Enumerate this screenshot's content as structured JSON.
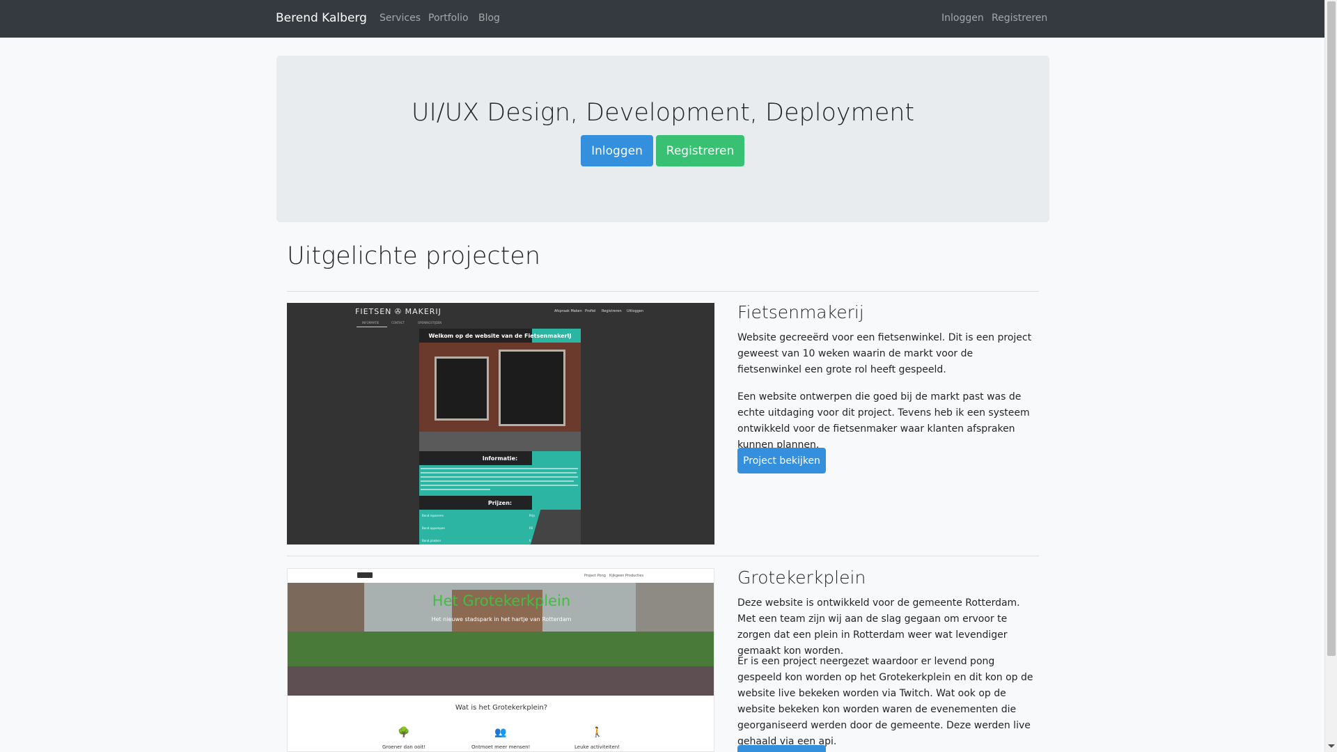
{
  "navbar": {
    "brand": "Berend Kalberg",
    "links": [
      "Services",
      "Portfolio",
      "Blog"
    ],
    "right_links": [
      "Inloggen",
      "Registreren"
    ]
  },
  "jumbotron": {
    "title": "UI/UX Design, Development, Deployment",
    "login_button": "Inloggen",
    "register_button": "Registreren"
  },
  "section": {
    "title": "Uitgelichte projecten"
  },
  "projects": [
    {
      "title": "Fietsenmakerij",
      "paragraph1": "Website gecreeërd voor een fietsenwinkel. Dit is een project geweest van 10 weken waarin de markt voor de fietsenwinkel een grote rol heeft gespeeld.",
      "paragraph2": "Een website ontwerpen die goed bij de markt past was de echte uitdaging voor dit project. Tevens heb ik een systeem ontwikkeld voor de fietsenmaker waar klanten afspraken kunnen plannen.",
      "button": "Project bekijken",
      "screenshot": {
        "logo": "FIETSEN ✇ MAKERIJ",
        "menu": [
          "Afspraak Maken",
          "Profiel",
          "Registreren",
          "Uitloggen"
        ],
        "subnav": [
          "INFORMATIE",
          "CONTACT",
          "OPENINGSTIJDEN"
        ],
        "welcome": "Welkom op de website van de FietsenmakerIJ",
        "info_header": "Informatie:",
        "prices_header": "Prijzen:",
        "price_rows": [
          "Band repareren",
          "Band oppompen",
          "Band plakken"
        ],
        "price_values": [
          "Prijs",
          "€6",
          "€..."
        ]
      }
    },
    {
      "title": "Grotekerkplein",
      "paragraph1": "Deze website is ontwikkeld voor de gemeente Rotterdam. Met een team zijn wij aan de slag gegaan om ervoor te zorgen dat een plein in Rotterdam weer wat levendiger gemaakt kon worden.",
      "paragraph2": "Er is een project neergezet waardoor er levend pong gespeeld kon worden op het Grotekerkplein en dit kon op de website live bekeken worden via Twitch. Wat ook op de website bekeken kon worden waren de evenementen die georganiseerd werden door de gemeente. Deze werden live gehaald via een api.",
      "screenshot": {
        "menu": [
          "Project Pong",
          "Kijkgeen Producties"
        ],
        "hero_title": "Het Grotekerkplein",
        "hero_subtitle": "Het nieuwe stadspark in het hartje van Rotterdam",
        "question": "Wat is het Grotekerkplein?",
        "features": [
          "Groener dan ooit!",
          "Ontmoet meer mensen!",
          "Leuke activiteiten!"
        ]
      }
    }
  ],
  "icons": [
    "tree-icon",
    "people-icon",
    "person-icon"
  ],
  "colors": {
    "navbar_bg": "#343a40",
    "primary": "#3490dc",
    "success": "#38c172",
    "jumbotron_bg": "#e9ecef",
    "page_bg": "#f8f9fa"
  }
}
